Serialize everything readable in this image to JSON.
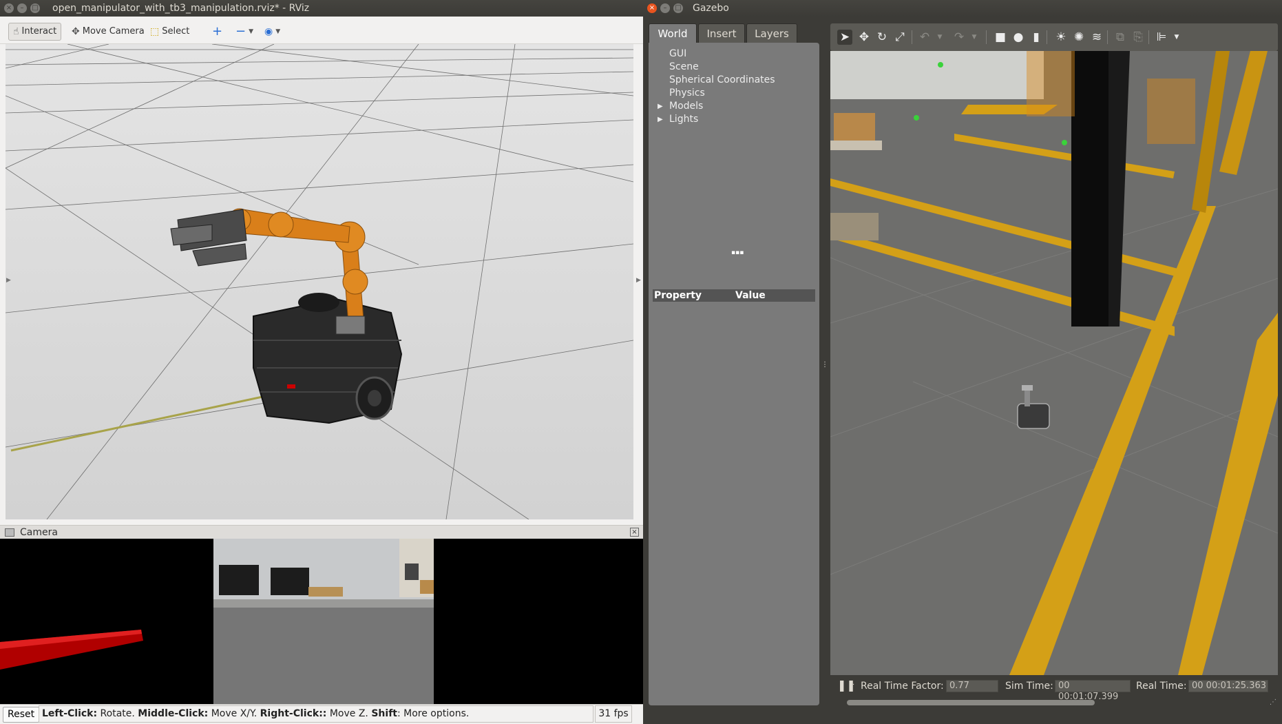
{
  "rviz": {
    "window_title": "open_manipulator_with_tb3_manipulation.rviz* - RViz",
    "toolbar": {
      "interact": "Interact",
      "move_camera": "Move Camera",
      "select": "Select"
    },
    "camera_panel_title": "Camera",
    "status": {
      "reset": "Reset",
      "left_click": "Left-Click:",
      "left_click_action": "Rotate.",
      "middle_click": "Middle-Click:",
      "middle_click_action": "Move X/Y.",
      "right_click": "Right-Click::",
      "right_click_action": "Move Z.",
      "shift": "Shift",
      "shift_action": ": More options.",
      "fps": "31 fps"
    }
  },
  "gazebo": {
    "window_title": "Gazebo",
    "tabs": [
      "World",
      "Insert",
      "Layers"
    ],
    "active_tab": "World",
    "tree": [
      {
        "label": "GUI",
        "expandable": false
      },
      {
        "label": "Scene",
        "expandable": false
      },
      {
        "label": "Spherical Coordinates",
        "expandable": false
      },
      {
        "label": "Physics",
        "expandable": false
      },
      {
        "label": "Models",
        "expandable": true
      },
      {
        "label": "Lights",
        "expandable": true
      }
    ],
    "property_header": {
      "property": "Property",
      "value": "Value"
    },
    "bottom": {
      "real_time_factor_label": "Real Time Factor:",
      "real_time_factor": "0.77",
      "sim_time_label": "Sim Time:",
      "sim_time": "00 00:01:07.399",
      "real_time_label": "Real Time:",
      "real_time": "00 00:01:25.363"
    },
    "toolbar_icons": [
      "select-arrow-icon",
      "translate-icon",
      "rotate-icon",
      "scale-icon",
      "undo-icon",
      "redo-icon",
      "box-icon",
      "sphere-icon",
      "cylinder-icon",
      "point-light-icon",
      "spot-light-icon",
      "directional-light-icon",
      "copy-icon",
      "paste-icon",
      "align-icon"
    ]
  },
  "colors": {
    "title_bar": "#3c3b37",
    "close_button": "#e9541f",
    "robot_arm": "#d97f1a",
    "floor_stripe": "#d4a017"
  }
}
